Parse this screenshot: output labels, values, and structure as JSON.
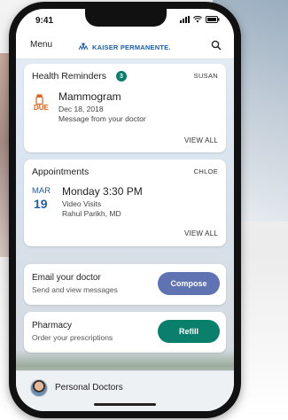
{
  "status_bar": {
    "time": "9:41"
  },
  "header": {
    "menu_label": "Menu",
    "brand": "KAISER PERMANENTE."
  },
  "health_reminders": {
    "title": "Health Reminders",
    "count": "3",
    "owner": "SUSAN",
    "item": {
      "due_label": "DUE",
      "title": "Mammogram",
      "date": "Dec 18, 2018",
      "message": "Message from your doctor"
    },
    "view_all": "VIEW ALL"
  },
  "appointments": {
    "title": "Appointments",
    "owner": "CHLOE",
    "item": {
      "month": "MAR",
      "day": "19",
      "title": "Monday 3:30 PM",
      "type": "Video Visits",
      "doctor": "Rahul Parikh, MD"
    },
    "view_all": "VIEW ALL"
  },
  "email": {
    "title": "Email your doctor",
    "subtitle": "Send and view messages",
    "button": "Compose"
  },
  "pharmacy": {
    "title": "Pharmacy",
    "subtitle": "Order your prescriptions",
    "button": "Refill"
  },
  "bottom_bar": {
    "label": "Personal Doctors"
  },
  "icons": {
    "search": "search-icon",
    "signal": "signal-icon",
    "wifi": "wifi-icon",
    "battery": "battery-icon",
    "brand_logo": "kp-logo-icon",
    "medication": "medication-bottle-icon"
  },
  "colors": {
    "brand_blue": "#1f5ea8",
    "due_orange": "#d8621c",
    "refill_green": "#0a7f6b",
    "compose_blue": "#5f72b2"
  }
}
